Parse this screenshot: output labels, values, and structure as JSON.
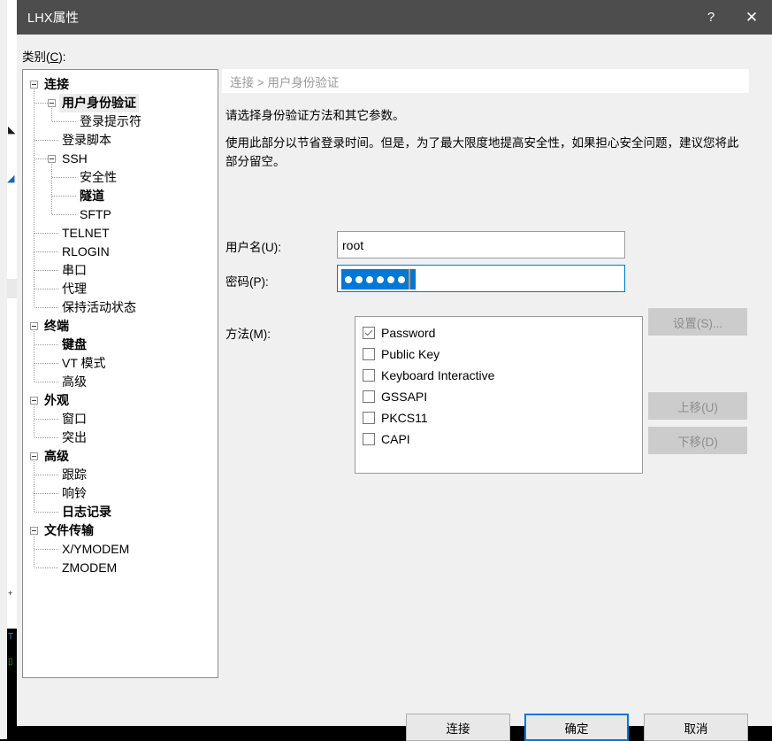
{
  "window": {
    "title": "LHX属性",
    "help_label": "?",
    "close_label": "✕"
  },
  "category": {
    "label_prefix": "类别(",
    "label_accel": "C",
    "label_suffix": "):"
  },
  "tree": {
    "nodes": [
      {
        "label": "连接",
        "depth": 0,
        "bold": true,
        "selected": false,
        "expandable": true,
        "expanded": true
      },
      {
        "label": "用户身份验证",
        "depth": 1,
        "bold": true,
        "selected": true,
        "expandable": true,
        "expanded": true
      },
      {
        "label": "登录提示符",
        "depth": 2,
        "bold": false,
        "selected": false,
        "expandable": false,
        "expanded": false
      },
      {
        "label": "登录脚本",
        "depth": 1,
        "bold": false,
        "selected": false,
        "expandable": false,
        "expanded": false
      },
      {
        "label": "SSH",
        "depth": 1,
        "bold": false,
        "selected": false,
        "expandable": true,
        "expanded": true
      },
      {
        "label": "安全性",
        "depth": 2,
        "bold": false,
        "selected": false,
        "expandable": false,
        "expanded": false
      },
      {
        "label": "隧道",
        "depth": 2,
        "bold": true,
        "selected": false,
        "expandable": false,
        "expanded": false
      },
      {
        "label": "SFTP",
        "depth": 2,
        "bold": false,
        "selected": false,
        "expandable": false,
        "expanded": false
      },
      {
        "label": "TELNET",
        "depth": 1,
        "bold": false,
        "selected": false,
        "expandable": false,
        "expanded": false
      },
      {
        "label": "RLOGIN",
        "depth": 1,
        "bold": false,
        "selected": false,
        "expandable": false,
        "expanded": false
      },
      {
        "label": "串口",
        "depth": 1,
        "bold": false,
        "selected": false,
        "expandable": false,
        "expanded": false
      },
      {
        "label": "代理",
        "depth": 1,
        "bold": false,
        "selected": false,
        "expandable": false,
        "expanded": false
      },
      {
        "label": "保持活动状态",
        "depth": 1,
        "bold": false,
        "selected": false,
        "expandable": false,
        "expanded": false
      },
      {
        "label": "终端",
        "depth": 0,
        "bold": true,
        "selected": false,
        "expandable": true,
        "expanded": true
      },
      {
        "label": "键盘",
        "depth": 1,
        "bold": true,
        "selected": false,
        "expandable": false,
        "expanded": false
      },
      {
        "label": "VT 模式",
        "depth": 1,
        "bold": false,
        "selected": false,
        "expandable": false,
        "expanded": false
      },
      {
        "label": "高级",
        "depth": 1,
        "bold": false,
        "selected": false,
        "expandable": false,
        "expanded": false
      },
      {
        "label": "外观",
        "depth": 0,
        "bold": true,
        "selected": false,
        "expandable": true,
        "expanded": true
      },
      {
        "label": "窗口",
        "depth": 1,
        "bold": false,
        "selected": false,
        "expandable": false,
        "expanded": false
      },
      {
        "label": "突出",
        "depth": 1,
        "bold": false,
        "selected": false,
        "expandable": false,
        "expanded": false
      },
      {
        "label": "高级",
        "depth": 0,
        "bold": true,
        "selected": false,
        "expandable": true,
        "expanded": true
      },
      {
        "label": "跟踪",
        "depth": 1,
        "bold": false,
        "selected": false,
        "expandable": false,
        "expanded": false
      },
      {
        "label": "响铃",
        "depth": 1,
        "bold": false,
        "selected": false,
        "expandable": false,
        "expanded": false
      },
      {
        "label": "日志记录",
        "depth": 1,
        "bold": true,
        "selected": false,
        "expandable": false,
        "expanded": false
      },
      {
        "label": "文件传输",
        "depth": 0,
        "bold": true,
        "selected": false,
        "expandable": true,
        "expanded": true
      },
      {
        "label": "X/YMODEM",
        "depth": 1,
        "bold": false,
        "selected": false,
        "expandable": false,
        "expanded": false
      },
      {
        "label": "ZMODEM",
        "depth": 1,
        "bold": false,
        "selected": false,
        "expandable": false,
        "expanded": false
      }
    ]
  },
  "content": {
    "breadcrumb": "连接 > 用户身份验证",
    "description_line1": "请选择身份验证方法和其它参数。",
    "description_line2": "使用此部分以节省登录时间。但是，为了最大限度地提高安全性，如果担心安全问题，建议您将此部分留空。",
    "username_label": "用户名(U):",
    "username_value": "root",
    "username_placeholder": "",
    "password_label": "密码(P):",
    "password_masked_chars": 6,
    "password_selected": true,
    "method_label": "方法(M):",
    "methods": [
      {
        "label": "Password",
        "checked": true
      },
      {
        "label": "Public Key",
        "checked": false
      },
      {
        "label": "Keyboard Interactive",
        "checked": false
      },
      {
        "label": "GSSAPI",
        "checked": false
      },
      {
        "label": "PKCS11",
        "checked": false
      },
      {
        "label": "CAPI",
        "checked": false
      }
    ],
    "side_buttons": [
      {
        "label": "设置(S)...",
        "enabled": false
      },
      {
        "label": "上移(U)",
        "enabled": false
      },
      {
        "label": "下移(D)",
        "enabled": false
      }
    ]
  },
  "footer": {
    "connect_label": "连接",
    "ok_label": "确定",
    "cancel_label": "取消",
    "default_button": "确定"
  },
  "colors": {
    "titlebar": "#4d4d4d",
    "dialog_bg": "#f0f0f0",
    "accent_focus": "#0078d7",
    "selection_bg": "#0078d7",
    "caret": "#e8912d",
    "disabled_button_bg": "#cccccc",
    "disabled_text": "#8d8d8d",
    "breadcrumb_text": "#9a9a9a"
  }
}
